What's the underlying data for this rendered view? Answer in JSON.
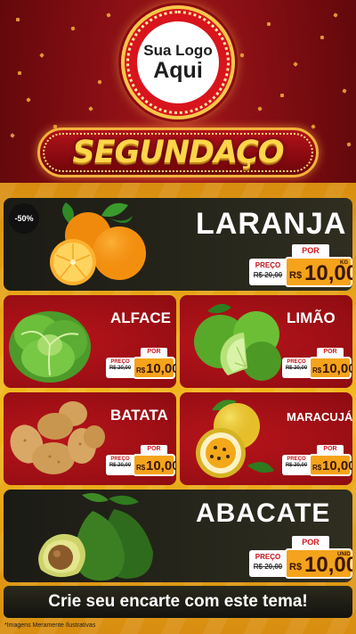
{
  "logo": {
    "line1": "Sua Logo",
    "line2": "Aqui"
  },
  "banner": {
    "title": "SEGUNDAÇO"
  },
  "products": [
    {
      "name": "LARANJA",
      "discount": "-50%",
      "por": "POR",
      "preco": "PREÇO",
      "old": "R$ 20,00",
      "cur": "R$",
      "price": "10,00",
      "unit": "KG"
    },
    {
      "name": "ALFACE",
      "por": "POR",
      "preco": "PREÇO",
      "old": "R$ 20,00",
      "cur": "R$",
      "price": "10,00"
    },
    {
      "name": "LIMÃO",
      "por": "POR",
      "preco": "PREÇO",
      "old": "R$ 20,00",
      "cur": "R$",
      "price": "10,00"
    },
    {
      "name": "BATATA",
      "por": "POR",
      "preco": "PREÇO",
      "old": "R$ 20,00",
      "cur": "R$",
      "price": "10,00"
    },
    {
      "name": "MARACUJÁ",
      "por": "POR",
      "preco": "PREÇO",
      "old": "R$ 20,00",
      "cur": "R$",
      "price": "10,00"
    },
    {
      "name": "ABACATE",
      "por": "POR",
      "preco": "PREÇO",
      "old": "R$ 20,00",
      "cur": "R$",
      "price": "10,00",
      "unit": "UNID"
    }
  ],
  "footer": {
    "cta": "Crie seu encarte com este tema!",
    "disclaimer": "*Imagens Meramente Ilustrativas"
  },
  "colors": {
    "primary_red": "#d8141c",
    "gold": "#f3b23c",
    "price_orange": "#f4a31b",
    "dark_card": "#1b1b15"
  }
}
